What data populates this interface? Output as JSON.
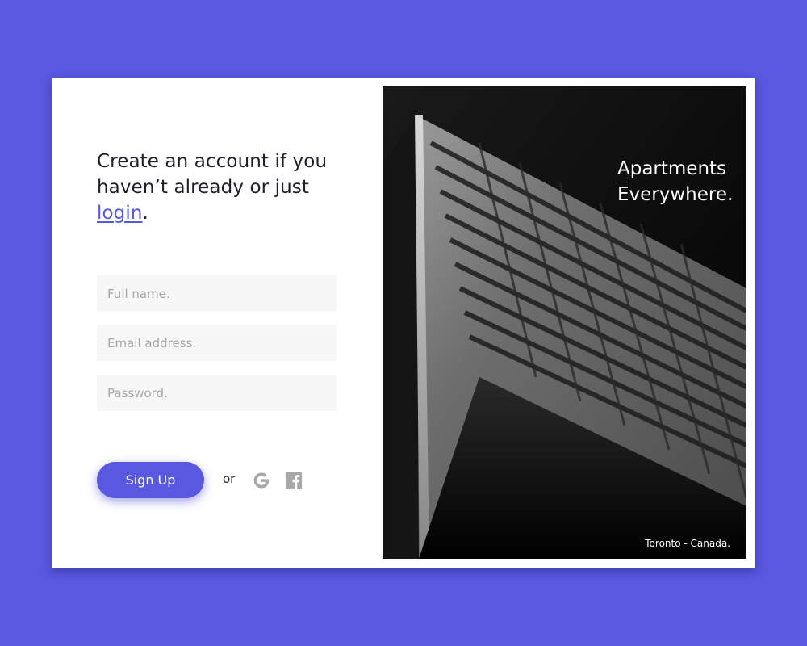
{
  "form": {
    "headline_text": "Create an account if you haven’t already or just ",
    "login_label": "login",
    "headline_end": ".",
    "fields": {
      "full_name_placeholder": "Full name.",
      "email_placeholder": "Email address.",
      "password_placeholder": "Password."
    },
    "signup_label": "Sign Up",
    "or_label": "or",
    "social_icons": [
      "google-icon",
      "facebook-icon"
    ]
  },
  "hero": {
    "title_line1": "Apartments",
    "title_line2": "Everywhere.",
    "location": "Toronto - Canada."
  },
  "colors": {
    "accent": "#5858E1",
    "background": "#5858E1",
    "input_bg": "#F7F7F7",
    "icon_gray": "#A8A8A8"
  }
}
